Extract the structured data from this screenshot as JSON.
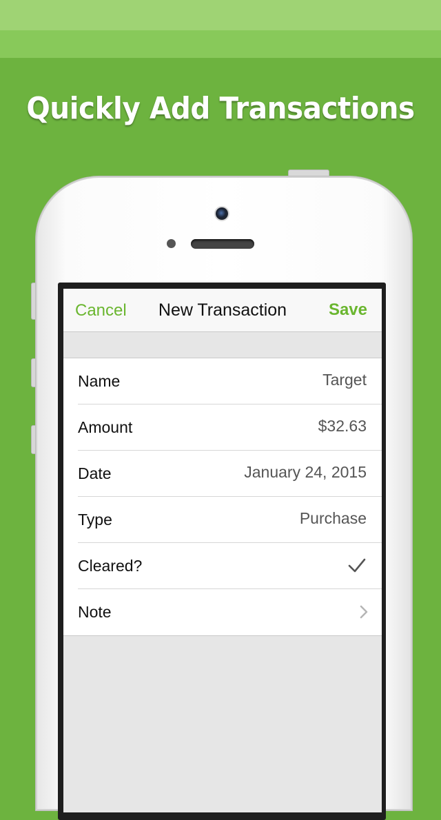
{
  "headline": "Quickly Add Transactions",
  "navbar": {
    "cancel_label": "Cancel",
    "title": "New Transaction",
    "save_label": "Save"
  },
  "form": {
    "rows": [
      {
        "label": "Name",
        "value": "Target"
      },
      {
        "label": "Amount",
        "value": "$32.63"
      },
      {
        "label": "Date",
        "value": "January 24, 2015"
      },
      {
        "label": "Type",
        "value": "Purchase"
      },
      {
        "label": "Cleared?",
        "icon": "checkmark-icon",
        "checked": true
      },
      {
        "label": "Note",
        "icon": "chevron-right-icon"
      }
    ]
  },
  "colors": {
    "background": "#6db33f",
    "accent": "#6ab62f"
  }
}
